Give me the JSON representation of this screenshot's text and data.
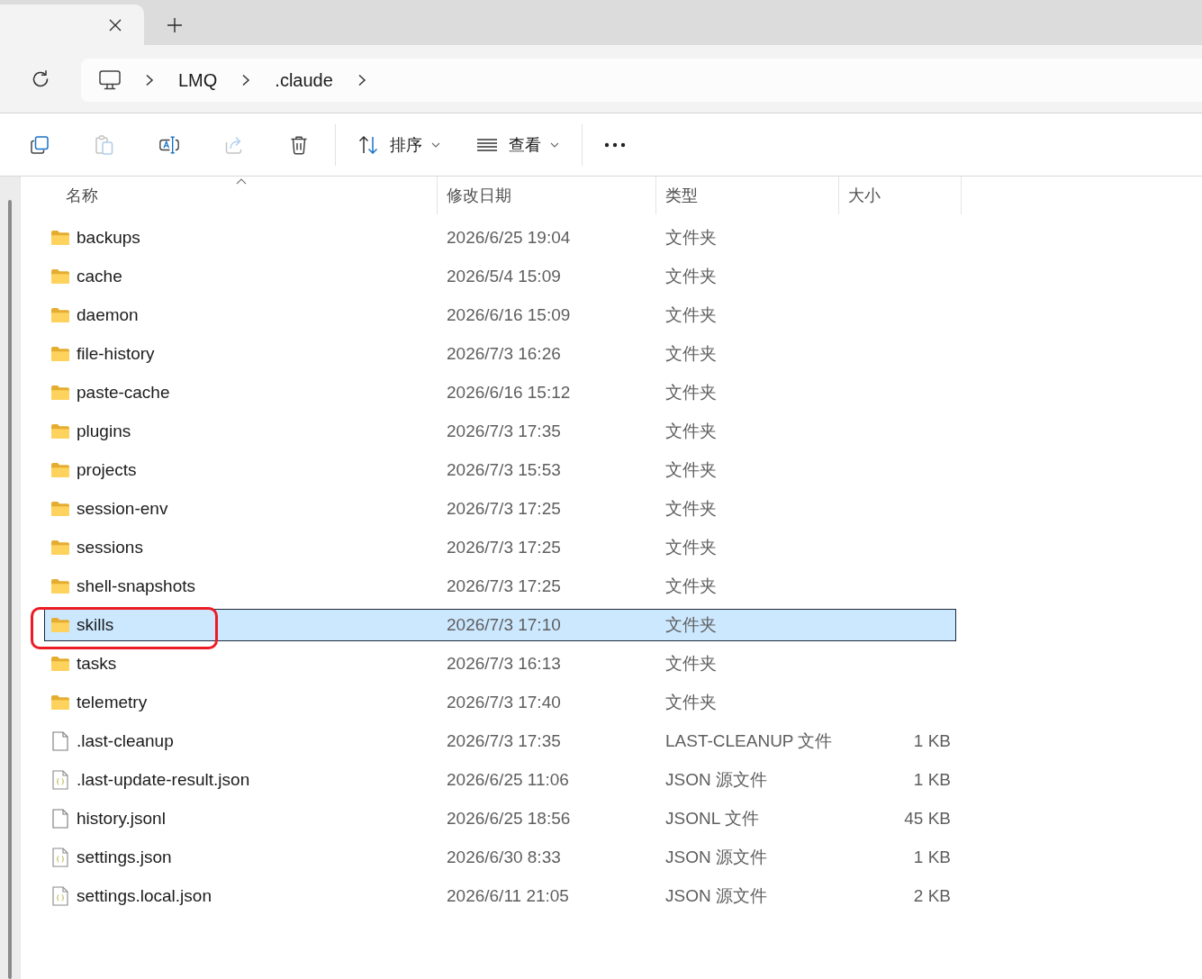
{
  "tabs": [
    {
      "selected": true
    }
  ],
  "address": {
    "crumbs": [
      "LMQ",
      ".claude"
    ]
  },
  "toolbar": {
    "actions": [
      {
        "kind": "copy",
        "disabled": false
      },
      {
        "kind": "paste",
        "disabled": true
      },
      {
        "kind": "rename",
        "disabled": false
      },
      {
        "kind": "share",
        "disabled": true
      },
      {
        "kind": "delete",
        "disabled": false
      }
    ],
    "sort": {
      "label": "排序"
    },
    "view": {
      "label": "查看"
    }
  },
  "columns": [
    {
      "label": "名称",
      "sorted": true
    },
    {
      "label": "修改日期",
      "sorted": false
    },
    {
      "label": "类型",
      "sorted": false
    },
    {
      "label": "大小",
      "sorted": false
    }
  ],
  "rows": [
    {
      "kind": "folder",
      "name": "backups",
      "date": "2026/6/25 19:04",
      "type": "文件夹",
      "selected": false,
      "annotated": false
    },
    {
      "kind": "folder",
      "name": "cache",
      "date": "2026/5/4 15:09",
      "type": "文件夹",
      "selected": false,
      "annotated": false
    },
    {
      "kind": "folder",
      "name": "daemon",
      "date": "2026/6/16 15:09",
      "type": "文件夹",
      "selected": false,
      "annotated": false
    },
    {
      "kind": "folder",
      "name": "file-history",
      "date": "2026/7/3 16:26",
      "type": "文件夹",
      "selected": false,
      "annotated": false
    },
    {
      "kind": "folder",
      "name": "paste-cache",
      "date": "2026/6/16 15:12",
      "type": "文件夹",
      "selected": false,
      "annotated": false
    },
    {
      "kind": "folder",
      "name": "plugins",
      "date": "2026/7/3 17:35",
      "type": "文件夹",
      "selected": false,
      "annotated": false
    },
    {
      "kind": "folder",
      "name": "projects",
      "date": "2026/7/3 15:53",
      "type": "文件夹",
      "selected": false,
      "annotated": false
    },
    {
      "kind": "folder",
      "name": "session-env",
      "date": "2026/7/3 17:25",
      "type": "文件夹",
      "selected": false,
      "annotated": false
    },
    {
      "kind": "folder",
      "name": "sessions",
      "date": "2026/7/3 17:25",
      "type": "文件夹",
      "selected": false,
      "annotated": false
    },
    {
      "kind": "folder",
      "name": "shell-snapshots",
      "date": "2026/7/3 17:25",
      "type": "文件夹",
      "selected": false,
      "annotated": false
    },
    {
      "kind": "folder",
      "name": "skills",
      "date": "2026/7/3 17:10",
      "type": "文件夹",
      "selected": true,
      "annotated": true
    },
    {
      "kind": "folder",
      "name": "tasks",
      "date": "2026/7/3 16:13",
      "type": "文件夹",
      "selected": false,
      "annotated": false
    },
    {
      "kind": "folder",
      "name": "telemetry",
      "date": "2026/7/3 17:40",
      "type": "文件夹",
      "selected": false,
      "annotated": false
    },
    {
      "kind": "file",
      "name": ".last-cleanup",
      "date": "2026/7/3 17:35",
      "type": "LAST-CLEANUP 文件",
      "size": "1 KB",
      "selected": false,
      "annotated": false
    },
    {
      "kind": "json",
      "name": ".last-update-result.json",
      "date": "2026/6/25 11:06",
      "type": "JSON 源文件",
      "size": "1 KB",
      "selected": false,
      "annotated": false
    },
    {
      "kind": "file",
      "name": "history.jsonl",
      "date": "2026/6/25 18:56",
      "type": "JSONL 文件",
      "size": "45 KB",
      "selected": false,
      "annotated": false
    },
    {
      "kind": "json",
      "name": "settings.json",
      "date": "2026/6/30 8:33",
      "type": "JSON 源文件",
      "size": "1 KB",
      "selected": false,
      "annotated": false
    },
    {
      "kind": "json",
      "name": "settings.local.json",
      "date": "2026/6/11 21:05",
      "type": "JSON 源文件",
      "size": "2 KB",
      "selected": false,
      "annotated": false
    }
  ]
}
